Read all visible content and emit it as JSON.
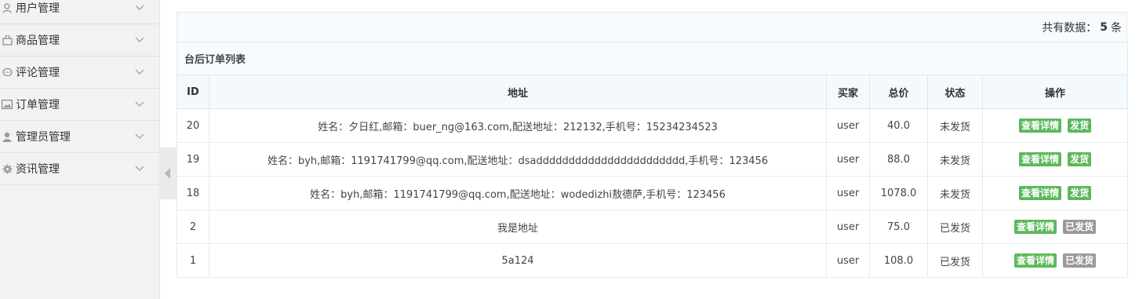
{
  "sidebar": {
    "items": [
      {
        "label": "用户管理",
        "icon": "user-icon"
      },
      {
        "label": "商品管理",
        "icon": "bag-icon"
      },
      {
        "label": "评论管理",
        "icon": "comment-icon"
      },
      {
        "label": "订单管理",
        "icon": "image-icon"
      },
      {
        "label": "管理员管理",
        "icon": "admin-icon"
      },
      {
        "label": "资讯管理",
        "icon": "gear-icon"
      }
    ]
  },
  "summary": {
    "prefix": "共有数据：",
    "count": "5",
    "suffix": "条"
  },
  "table": {
    "caption": "台后订单列表",
    "headers": [
      "ID",
      "地址",
      "买家",
      "总价",
      "状态",
      "操作"
    ],
    "rows": [
      {
        "id": "20",
        "address": "姓名：夕日红,邮箱：buer_ng@163.com,配送地址：212132,手机号：15234234523",
        "buyer": "user",
        "total": "40.0",
        "status": "未发货",
        "view": "查看详情",
        "ship": "发货",
        "shipped": false
      },
      {
        "id": "19",
        "address": "姓名：byh,邮箱：1191741799@qq.com,配送地址：dsaddddddddddddddddddddddd,手机号：123456",
        "buyer": "user",
        "total": "88.0",
        "status": "未发货",
        "view": "查看详情",
        "ship": "发货",
        "shipped": false
      },
      {
        "id": "18",
        "address": "姓名：byh,邮箱：1191741799@qq.com,配送地址：wodedizhi敖德萨,手机号：123456",
        "buyer": "user",
        "total": "1078.0",
        "status": "未发货",
        "view": "查看详情",
        "ship": "发货",
        "shipped": false
      },
      {
        "id": "2",
        "address": "我是地址",
        "buyer": "user",
        "total": "75.0",
        "status": "已发货",
        "view": "查看详情",
        "ship": "已发货",
        "shipped": true
      },
      {
        "id": "1",
        "address": "5a124",
        "buyer": "user",
        "total": "108.0",
        "status": "已发货",
        "view": "查看详情",
        "ship": "已发货",
        "shipped": true
      }
    ]
  },
  "colors": {
    "green_button": "#5cb85c",
    "gray_button": "#999999",
    "sidebar_bg": "#f2f2f2"
  }
}
